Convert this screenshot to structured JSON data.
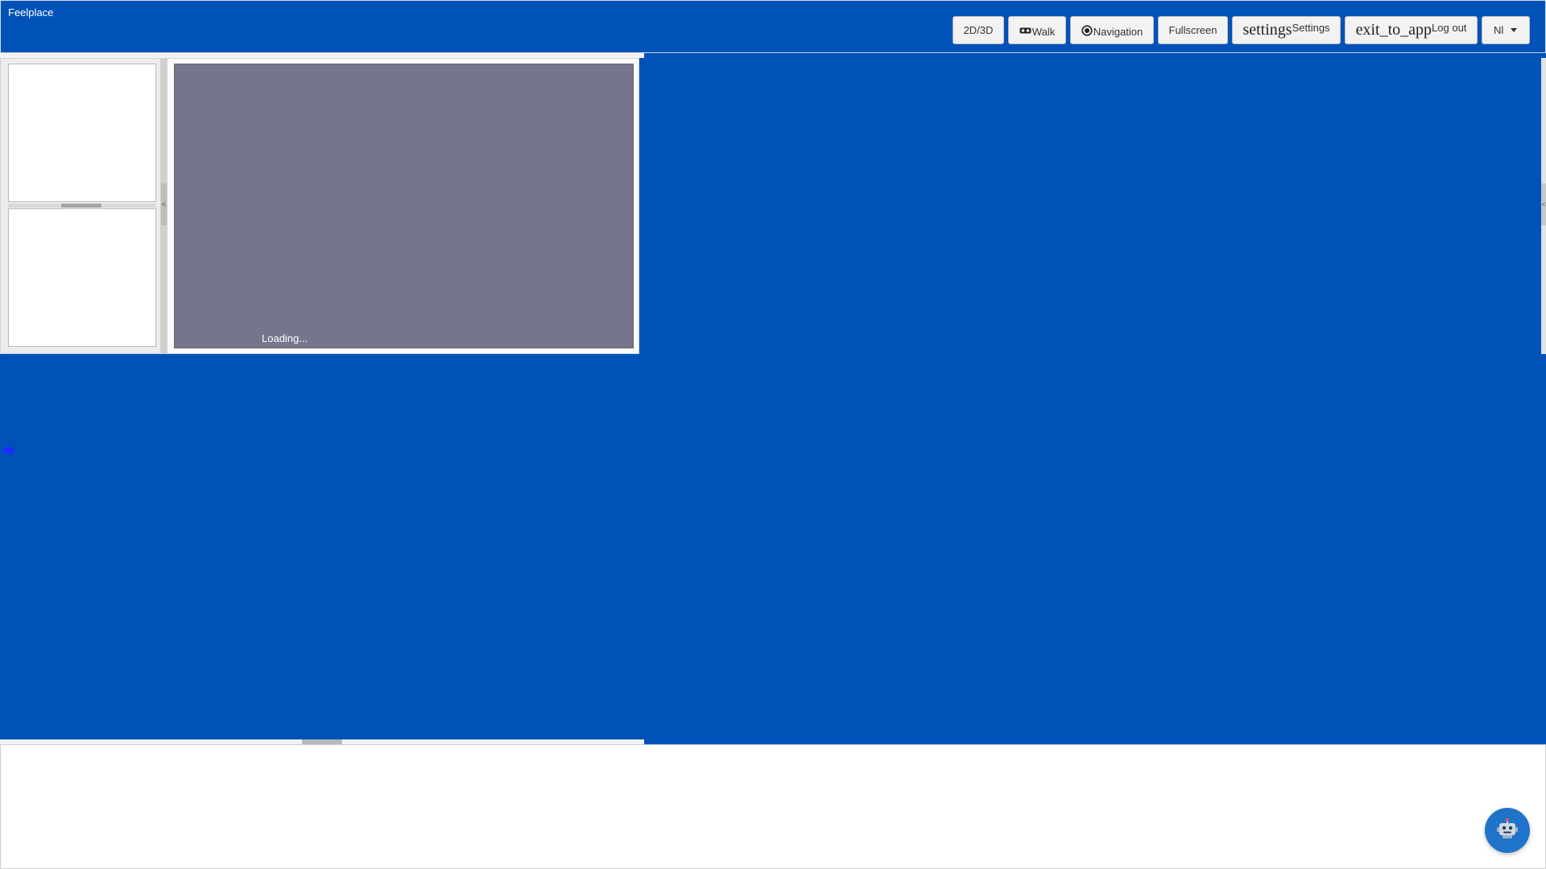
{
  "app": {
    "title": "Feelplace"
  },
  "toolbar": {
    "toggle_2d3d_label": "2D/3D",
    "walk_label": "Walk",
    "walk_icon": "vr-goggles-icon",
    "navigation_label": "Navigation",
    "navigation_icon": "radio-button-icon",
    "fullscreen_label": "Fullscreen",
    "settings_icon_text": "settings",
    "settings_label": "Settings",
    "logout_icon_text": "exit_to_app",
    "logout_label": "Log out",
    "language_selected": "Nl"
  },
  "viewer": {
    "loading_text": "Loading..."
  },
  "panels": {
    "collapse_left_glyph": "<",
    "collapse_right_glyph": "<"
  },
  "chat": {
    "icon": "robot-icon"
  },
  "colors": {
    "background": "#0052b9",
    "viewer": "#75758d",
    "chat_button": "#1f73c9"
  }
}
